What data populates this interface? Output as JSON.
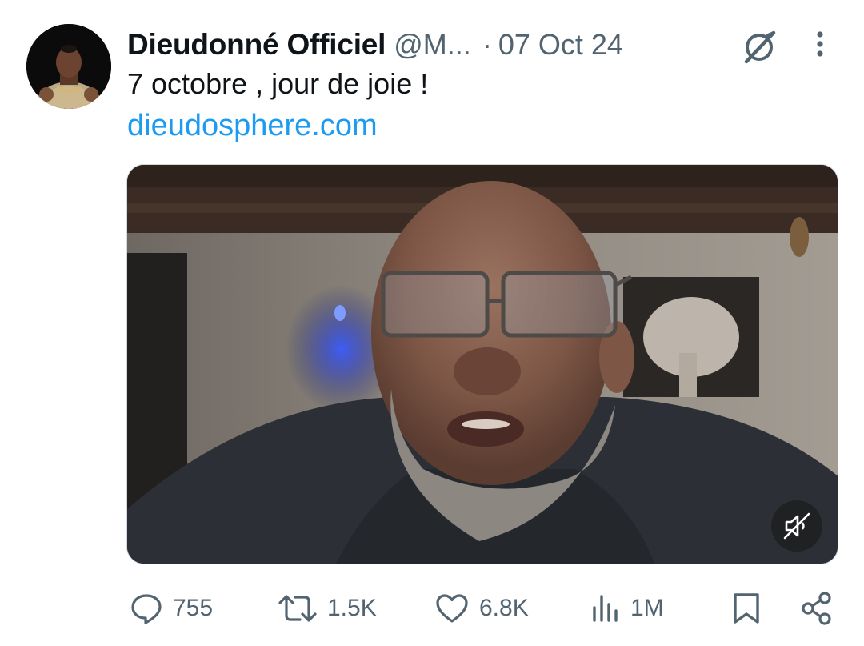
{
  "tweet": {
    "display_name": "Dieudonné Officiel",
    "handle": "@M...",
    "separator": "·",
    "date": "07 Oct 24",
    "text": "7 octobre , jour de joie !",
    "link": "dieudosphere.com"
  },
  "icons": {
    "avatar": "avatar",
    "grok": "grok-icon",
    "more": "more-vertical-icon",
    "video": "video-frame",
    "mute": "muted-speaker-icon",
    "reply": "reply-icon",
    "retweet": "retweet-icon",
    "like": "heart-icon",
    "views": "analytics-icon",
    "bookmark": "bookmark-icon",
    "share": "share-icon"
  },
  "actions": {
    "replies": "755",
    "retweets": "1.5K",
    "likes": "6.8K",
    "views": "1M"
  },
  "colors": {
    "text": "#0f1419",
    "secondary": "#536471",
    "link": "#1d9bf0"
  }
}
